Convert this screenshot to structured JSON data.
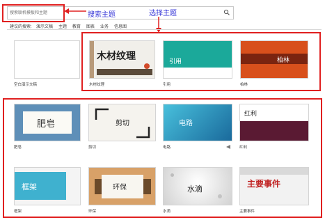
{
  "search": {
    "placeholder": "搜索联机模板和主题"
  },
  "annotations": {
    "search_theme": "搜索主题",
    "select_theme": "选择主题"
  },
  "categories": [
    "建议的搜索:",
    "演示文稿",
    "主题",
    "教育",
    "图表",
    "业务",
    "信息图"
  ],
  "row1": [
    {
      "label": "空白演示文稿",
      "title": ""
    },
    {
      "label": "木材纹理",
      "title": "木材纹理"
    },
    {
      "label": "引用",
      "title": "引用"
    },
    {
      "label": "柏林",
      "title": "柏林"
    }
  ],
  "row2": [
    {
      "label": "肥皂",
      "title": "肥皂"
    },
    {
      "label": "剪切",
      "title": "剪切"
    },
    {
      "label": "电路",
      "title": "电路"
    },
    {
      "label": "红利",
      "title": "红利"
    }
  ],
  "row3": [
    {
      "label": "框架",
      "title": "框架"
    },
    {
      "label": "环保",
      "title": "环保"
    },
    {
      "label": "水滴",
      "title": "水滴"
    },
    {
      "label": "主要事件",
      "title": "主要事件"
    }
  ],
  "colors": {
    "highlight_red": "#e02020",
    "annotation_blue": "#3a3ad8"
  }
}
